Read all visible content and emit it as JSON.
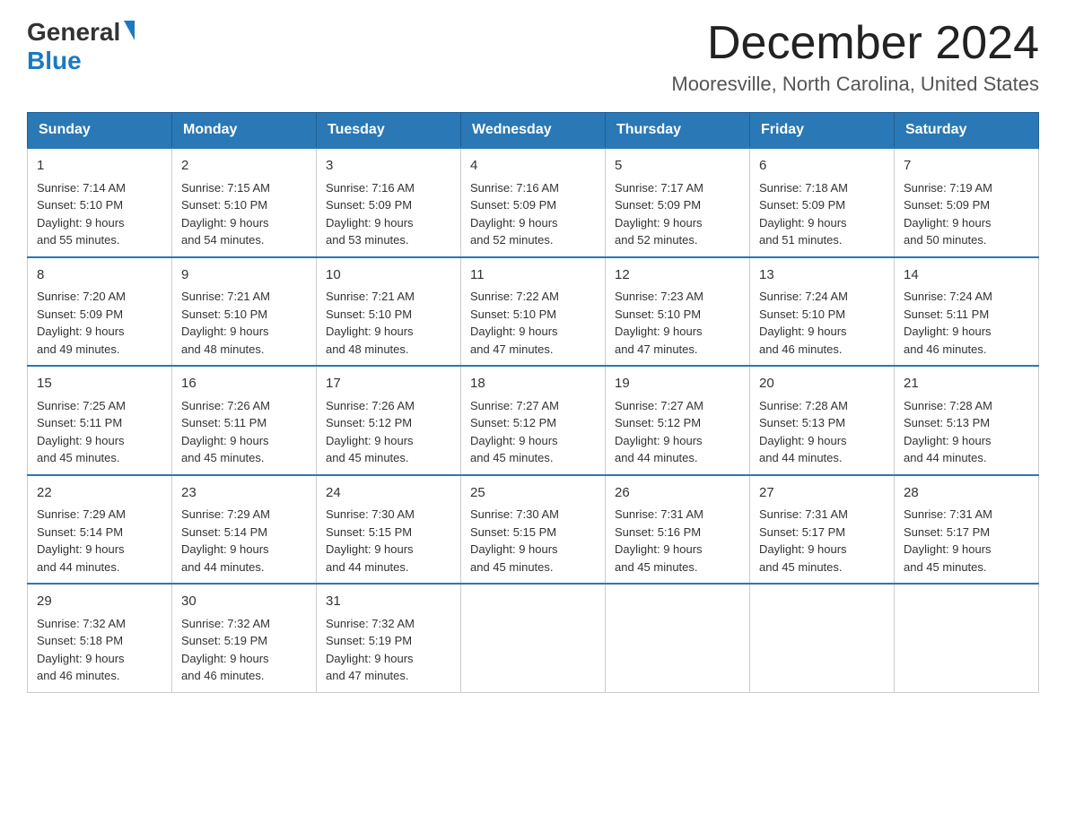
{
  "header": {
    "logo_general": "General",
    "logo_blue": "Blue",
    "month_title": "December 2024",
    "location": "Mooresville, North Carolina, United States"
  },
  "days_of_week": [
    "Sunday",
    "Monday",
    "Tuesday",
    "Wednesday",
    "Thursday",
    "Friday",
    "Saturday"
  ],
  "weeks": [
    [
      {
        "day": "1",
        "sunrise": "7:14 AM",
        "sunset": "5:10 PM",
        "daylight": "9 hours and 55 minutes."
      },
      {
        "day": "2",
        "sunrise": "7:15 AM",
        "sunset": "5:10 PM",
        "daylight": "9 hours and 54 minutes."
      },
      {
        "day": "3",
        "sunrise": "7:16 AM",
        "sunset": "5:09 PM",
        "daylight": "9 hours and 53 minutes."
      },
      {
        "day": "4",
        "sunrise": "7:16 AM",
        "sunset": "5:09 PM",
        "daylight": "9 hours and 52 minutes."
      },
      {
        "day": "5",
        "sunrise": "7:17 AM",
        "sunset": "5:09 PM",
        "daylight": "9 hours and 52 minutes."
      },
      {
        "day": "6",
        "sunrise": "7:18 AM",
        "sunset": "5:09 PM",
        "daylight": "9 hours and 51 minutes."
      },
      {
        "day": "7",
        "sunrise": "7:19 AM",
        "sunset": "5:09 PM",
        "daylight": "9 hours and 50 minutes."
      }
    ],
    [
      {
        "day": "8",
        "sunrise": "7:20 AM",
        "sunset": "5:09 PM",
        "daylight": "9 hours and 49 minutes."
      },
      {
        "day": "9",
        "sunrise": "7:21 AM",
        "sunset": "5:10 PM",
        "daylight": "9 hours and 48 minutes."
      },
      {
        "day": "10",
        "sunrise": "7:21 AM",
        "sunset": "5:10 PM",
        "daylight": "9 hours and 48 minutes."
      },
      {
        "day": "11",
        "sunrise": "7:22 AM",
        "sunset": "5:10 PM",
        "daylight": "9 hours and 47 minutes."
      },
      {
        "day": "12",
        "sunrise": "7:23 AM",
        "sunset": "5:10 PM",
        "daylight": "9 hours and 47 minutes."
      },
      {
        "day": "13",
        "sunrise": "7:24 AM",
        "sunset": "5:10 PM",
        "daylight": "9 hours and 46 minutes."
      },
      {
        "day": "14",
        "sunrise": "7:24 AM",
        "sunset": "5:11 PM",
        "daylight": "9 hours and 46 minutes."
      }
    ],
    [
      {
        "day": "15",
        "sunrise": "7:25 AM",
        "sunset": "5:11 PM",
        "daylight": "9 hours and 45 minutes."
      },
      {
        "day": "16",
        "sunrise": "7:26 AM",
        "sunset": "5:11 PM",
        "daylight": "9 hours and 45 minutes."
      },
      {
        "day": "17",
        "sunrise": "7:26 AM",
        "sunset": "5:12 PM",
        "daylight": "9 hours and 45 minutes."
      },
      {
        "day": "18",
        "sunrise": "7:27 AM",
        "sunset": "5:12 PM",
        "daylight": "9 hours and 45 minutes."
      },
      {
        "day": "19",
        "sunrise": "7:27 AM",
        "sunset": "5:12 PM",
        "daylight": "9 hours and 44 minutes."
      },
      {
        "day": "20",
        "sunrise": "7:28 AM",
        "sunset": "5:13 PM",
        "daylight": "9 hours and 44 minutes."
      },
      {
        "day": "21",
        "sunrise": "7:28 AM",
        "sunset": "5:13 PM",
        "daylight": "9 hours and 44 minutes."
      }
    ],
    [
      {
        "day": "22",
        "sunrise": "7:29 AM",
        "sunset": "5:14 PM",
        "daylight": "9 hours and 44 minutes."
      },
      {
        "day": "23",
        "sunrise": "7:29 AM",
        "sunset": "5:14 PM",
        "daylight": "9 hours and 44 minutes."
      },
      {
        "day": "24",
        "sunrise": "7:30 AM",
        "sunset": "5:15 PM",
        "daylight": "9 hours and 44 minutes."
      },
      {
        "day": "25",
        "sunrise": "7:30 AM",
        "sunset": "5:15 PM",
        "daylight": "9 hours and 45 minutes."
      },
      {
        "day": "26",
        "sunrise": "7:31 AM",
        "sunset": "5:16 PM",
        "daylight": "9 hours and 45 minutes."
      },
      {
        "day": "27",
        "sunrise": "7:31 AM",
        "sunset": "5:17 PM",
        "daylight": "9 hours and 45 minutes."
      },
      {
        "day": "28",
        "sunrise": "7:31 AM",
        "sunset": "5:17 PM",
        "daylight": "9 hours and 45 minutes."
      }
    ],
    [
      {
        "day": "29",
        "sunrise": "7:32 AM",
        "sunset": "5:18 PM",
        "daylight": "9 hours and 46 minutes."
      },
      {
        "day": "30",
        "sunrise": "7:32 AM",
        "sunset": "5:19 PM",
        "daylight": "9 hours and 46 minutes."
      },
      {
        "day": "31",
        "sunrise": "7:32 AM",
        "sunset": "5:19 PM",
        "daylight": "9 hours and 47 minutes."
      },
      null,
      null,
      null,
      null
    ]
  ],
  "labels": {
    "sunrise_prefix": "Sunrise: ",
    "sunset_prefix": "Sunset: ",
    "daylight_prefix": "Daylight: "
  }
}
